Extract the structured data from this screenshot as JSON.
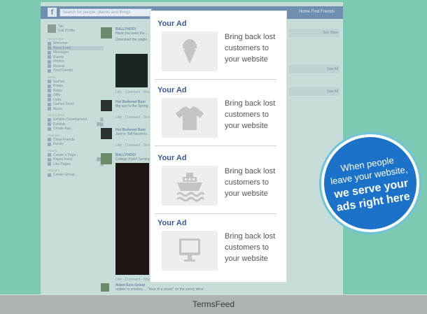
{
  "facebook": {
    "logo": "f",
    "search_placeholder": "Search for people, places and things",
    "top_right": "Home   Find Friends",
    "user": {
      "name": "Tao",
      "sub": "Edit Profile"
    },
    "sections": [
      {
        "title": "FAVORITES",
        "items": [
          {
            "label": "Welcome"
          },
          {
            "label": "News Feed",
            "selected": true
          },
          {
            "label": "Messages"
          },
          {
            "label": "Events"
          },
          {
            "label": "Photos"
          },
          {
            "label": "Browse"
          },
          {
            "label": "Find Friends"
          }
        ]
      },
      {
        "title": "APPS",
        "items": [
          {
            "label": "Games"
          },
          {
            "label": "Pokes"
          },
          {
            "label": "Notes"
          },
          {
            "label": "Gifts"
          },
          {
            "label": "Links"
          },
          {
            "label": "Games Feed"
          },
          {
            "label": "Music"
          }
        ]
      },
      {
        "title": "DEVELOPER",
        "items": [
          {
            "label": "Exhibits Development",
            "count": "1"
          },
          {
            "label": "Exhibits",
            "count": "20+"
          },
          {
            "label": "Create App..."
          }
        ]
      },
      {
        "title": "FRIENDS",
        "items": [
          {
            "label": "Close Friends"
          },
          {
            "label": "Family"
          }
        ]
      },
      {
        "title": "PAGES",
        "items": [
          {
            "label": "Create a Page..."
          },
          {
            "label": "Pages Feed",
            "count": "20+"
          },
          {
            "label": "Like Pages",
            "count": "1"
          }
        ]
      },
      {
        "title": "GROUPS",
        "items": [
          {
            "label": "Create Group..."
          }
        ]
      }
    ],
    "posts": [
      {
        "name": "BALLYHOO!",
        "text": "Have you seen the ... and our friend ...",
        "extra": "Download the single ...",
        "actions": "Like · Comment · Share"
      },
      {
        "name": "Hot Buttered Rum",
        "text": "Big ups to the Spring ... Stations! We're cal ...",
        "actions": "Like · Comment · Share"
      },
      {
        "name": "Hot Buttered Rum",
        "text": "Just in: Bill Nershi is ... down early!",
        "actions": "Like · Comment · Share"
      },
      {
        "name": "BALLYHOO!",
        "text": "College Park!! Serving ...",
        "actions": "Like · Comment · Share"
      },
      {
        "name": "Adam Ezra Group",
        "text": "replies to smokey ... \"hour of a clown\" on the sunny drive",
        "actions": ""
      }
    ],
    "right_links": [
      {
        "label": "See More"
      },
      {
        "label": "See All"
      },
      {
        "label": "See All"
      }
    ]
  },
  "ads": [
    {
      "title": "Your Ad",
      "text": "Bring back lost customers to your website",
      "icon": "ice-cream-icon"
    },
    {
      "title": "Your Ad",
      "text": "Bring back lost customers to your website",
      "icon": "tshirt-icon"
    },
    {
      "title": "Your Ad",
      "text": "Bring back lost customers to your website",
      "icon": "ship-icon"
    },
    {
      "title": "Your Ad",
      "text": "Bring back lost customers to your website",
      "icon": "monitor-icon"
    }
  ],
  "badge": {
    "line1": "When people",
    "line2": "leave your website,",
    "line3": "we serve your",
    "line4": "ads right here"
  },
  "footer": {
    "label": "TermsFeed"
  },
  "colors": {
    "background": "#7ec9b4",
    "badge": "#1b72c8",
    "ad_title": "#3b5999",
    "footer": "#acb3b2"
  }
}
